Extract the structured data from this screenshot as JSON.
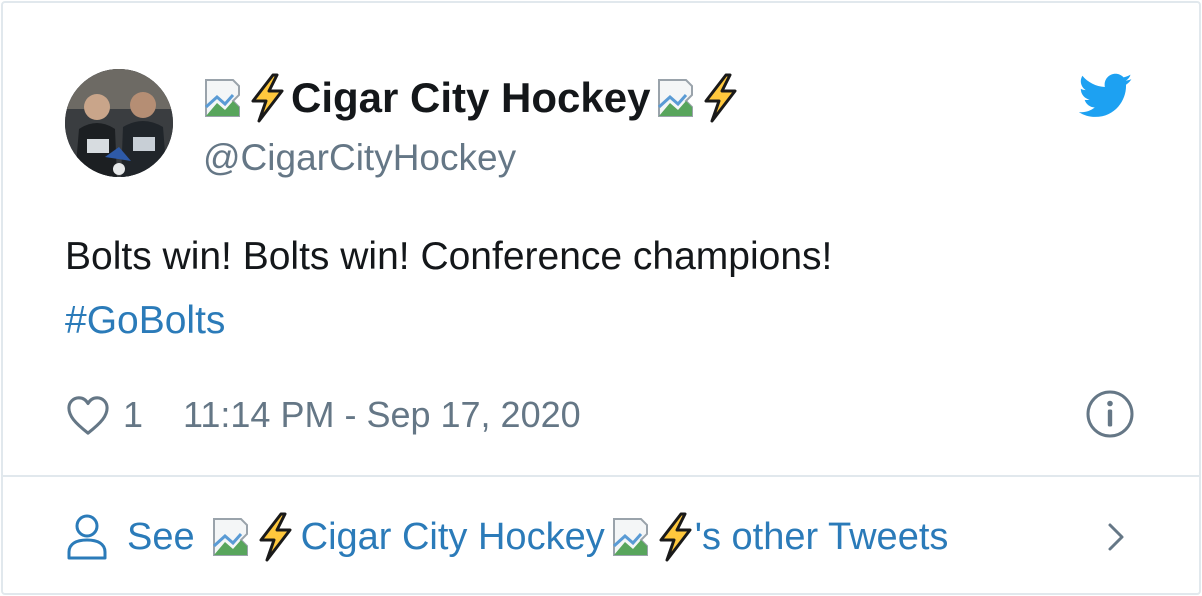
{
  "tweet": {
    "display_name": "Cigar City Hockey",
    "handle": "@CigarCityHockey",
    "text": "Bolts win! Bolts win! Conference champions!",
    "hashtag": "#GoBolts",
    "like_count": "1",
    "timestamp": "11:14 PM - Sep 17, 2020"
  },
  "footer": {
    "see_label": "See",
    "name": "Cigar City Hockey",
    "suffix": "'s other Tweets"
  },
  "icons": {
    "brand": "twitter-bird-icon",
    "like": "heart-icon",
    "info": "info-icon",
    "profile": "person-icon",
    "more": "chevron-right-icon",
    "emoji": "lightning-bolt-icon",
    "broken_image": "broken-image-icon"
  },
  "colors": {
    "twitter_blue": "#1da1f2",
    "link_blue": "#2b7bb9",
    "secondary_text": "#657786",
    "border": "#e1e8ed"
  }
}
